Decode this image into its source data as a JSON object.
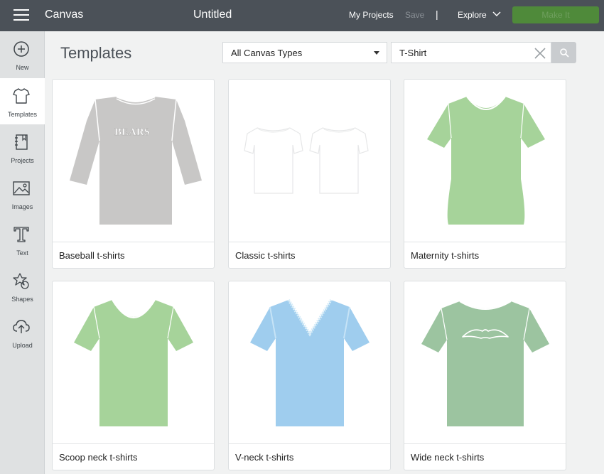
{
  "topbar": {
    "app_title": "Canvas",
    "doc_title": "Untitled",
    "my_projects": "My Projects",
    "save": "Save",
    "separator": "|",
    "explore": "Explore",
    "make_it": "Make It"
  },
  "sidebar": {
    "items": [
      {
        "label": "New",
        "icon": "plus-circle-icon"
      },
      {
        "label": "Templates",
        "icon": "tshirt-icon"
      },
      {
        "label": "Projects",
        "icon": "notebook-icon"
      },
      {
        "label": "Images",
        "icon": "image-icon"
      },
      {
        "label": "Text",
        "icon": "text-t-icon"
      },
      {
        "label": "Shapes",
        "icon": "shapes-icon"
      },
      {
        "label": "Upload",
        "icon": "cloud-upload-icon"
      }
    ],
    "active": "Templates"
  },
  "main": {
    "title": "Templates",
    "canvas_type_select": "All Canvas Types",
    "search_value": "T-Shirt"
  },
  "templates": [
    {
      "label": "Baseball t-shirts",
      "shirt_text": "BEARS"
    },
    {
      "label": "Classic t-shirts"
    },
    {
      "label": "Maternity t-shirts"
    },
    {
      "label": "Scoop neck t-shirts"
    },
    {
      "label": "V-neck t-shirts"
    },
    {
      "label": "Wide neck t-shirts"
    }
  ],
  "colors": {
    "topbar": "#4b5158",
    "make_it": "#4f8a3a",
    "shirt_gray": "#c8c7c6",
    "shirt_green": "#a6d39a",
    "shirt_blue": "#9fcdee",
    "shirt_sage": "#9cc4a0"
  }
}
